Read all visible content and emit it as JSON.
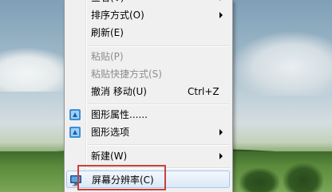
{
  "menu": {
    "partial_top_label": "查看(V)",
    "items": [
      {
        "label": "排序方式(O)",
        "submenu": true
      },
      {
        "label": "刷新(E)"
      },
      {
        "label": "粘贴(P)",
        "disabled": true
      },
      {
        "label": "粘贴快捷方式(S)",
        "disabled": true
      },
      {
        "label": "撤消 移动(U)",
        "shortcut": "Ctrl+Z"
      },
      {
        "label": "图形属性......",
        "icon": "graphics-properties-icon"
      },
      {
        "label": "图形选项",
        "icon": "graphics-options-icon",
        "submenu": true
      },
      {
        "label": "新建(W)",
        "submenu": true
      },
      {
        "label": "屏幕分辨率(C)",
        "icon": "screen-resolution-icon",
        "highlighted": true
      }
    ]
  },
  "annotation": {
    "color": "#c8413b"
  }
}
